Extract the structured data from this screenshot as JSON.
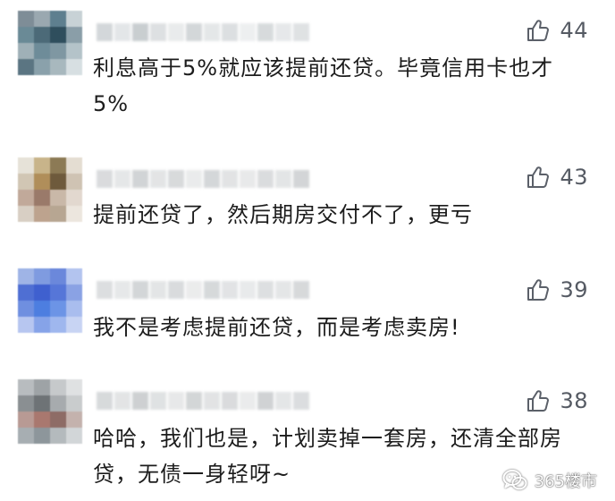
{
  "colors": {
    "background": "#ffffff",
    "text": "#1c1c1c",
    "like_count": "#555a63",
    "like_icon": "#5b6069"
  },
  "comments": [
    {
      "likes": "44",
      "text": "利息高于5%就应该提前还贷。毕竟信用卡也才5%",
      "avatar_colors": [
        "#7e8d97",
        "#9aa8b0",
        "#5e7f8f",
        "#c8d2d6",
        "#6a8a96",
        "#4c6a78",
        "#2f4e5d",
        "#8a9ea8",
        "#9fb0b7",
        "#6e8c99",
        "#7f97a2",
        "#b4c3c9",
        "#5b7582",
        "#8aa1ab",
        "#a8b8be",
        "#d7dfe2"
      ],
      "name_colors": [
        "#cfd3d6",
        "#e1e4e6",
        "#c4c9cc",
        "#dadddf",
        "#e7e9ea",
        "#cfd3d5",
        "#e2e5e6",
        "#d9dcde",
        "#eceeef",
        "#d3d7d9",
        "#e4e6e8",
        "#dcdfe1"
      ]
    },
    {
      "likes": "43",
      "text": "提前还贷了，然后期房交付不了，更亏",
      "avatar_colors": [
        "#e6e2d8",
        "#c8b48a",
        "#8c7a55",
        "#e4ddd2",
        "#d1c6b4",
        "#b08e5a",
        "#6e5a3c",
        "#cfc3b3",
        "#c1a99a",
        "#9a7a6a",
        "#c9b8a8",
        "#e2d8cf",
        "#d8cfc4",
        "#bda38e",
        "#b7a692",
        "#ece6de"
      ],
      "name_colors": [
        "#d6d8da",
        "#e3e5e6",
        "#cdd0d2",
        "#e0e2e3",
        "#d4d6d8",
        "#e8e9ea",
        "#d0d3d5",
        "#dfe1e2",
        "#e6e7e8",
        "#d7d9db",
        "#e1e3e4",
        "#cfd1d3"
      ]
    },
    {
      "likes": "39",
      "text": "我不是考虑提前还贷，而是考虑卖房!",
      "avatar_colors": [
        "#9fb4e6",
        "#7f9be0",
        "#6b88db",
        "#b3c4ef",
        "#4f6fd3",
        "#3f60cf",
        "#5676d8",
        "#8aa2e4",
        "#6f8fe0",
        "#4d7ee0",
        "#6c94e6",
        "#a9bdee",
        "#b7c6f0",
        "#86a3e8",
        "#9fb7ee",
        "#c8d4f3"
      ],
      "name_colors": [
        "#d9dbdd",
        "#e4e6e7",
        "#cfd2d4",
        "#e1e3e4",
        "#d5d8da",
        "#e9eaeb",
        "#d2d5d7",
        "#dfe1e3",
        "#e6e8e9",
        "#dadcde",
        "#e2e4e5",
        "#d3d5d7"
      ]
    },
    {
      "likes": "38",
      "text": "哈哈，我们也是，计划卖掉一套房，还清全部房贷，无债一身轻呀~",
      "avatar_colors": [
        "#b8bcbf",
        "#9ea3a6",
        "#c6c9cb",
        "#dfe1e2",
        "#8a8f92",
        "#6e7376",
        "#a7abae",
        "#c9cccd",
        "#b89a94",
        "#a9786f",
        "#8e6c66",
        "#c4b2ad",
        "#a7aeb2",
        "#8d969b",
        "#b4babd",
        "#d2d6d8"
      ],
      "name_colors": [
        "#d3d6d8",
        "#e0e2e3",
        "#c9ccce",
        "#dcdfe0",
        "#e5e6e7",
        "#cfd2d3",
        "#dfe1e2",
        "#d6d8da",
        "#e8e9ea",
        "#cbced0",
        "#e2e4e5",
        "#d8dadc"
      ]
    }
  ],
  "watermark": {
    "text": "365楼市",
    "icon": "wechat-icon"
  }
}
